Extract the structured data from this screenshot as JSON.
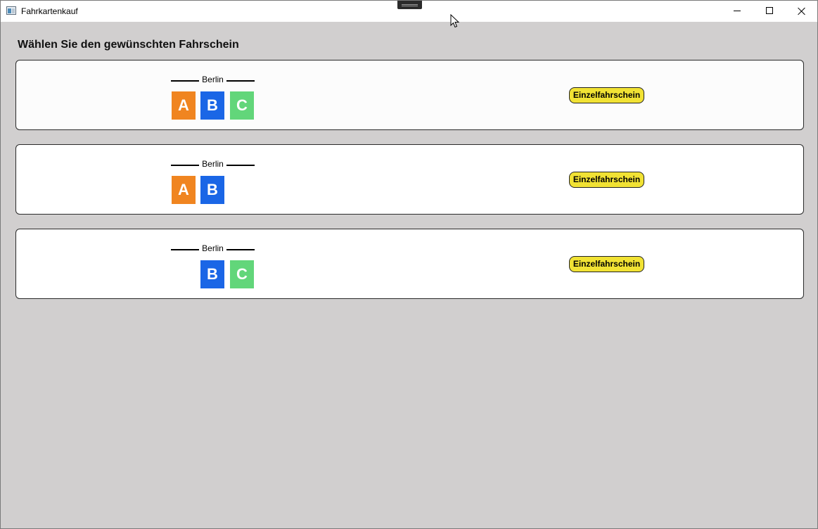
{
  "window": {
    "title": "Fahrkartenkauf",
    "icon": "app-window-icon"
  },
  "heading": "Wählen Sie den gewünschten Fahrschein",
  "colors": {
    "background": "#d1cfcf",
    "card": "#ffffff",
    "zone_a": "#f08520",
    "zone_b": "#1a66e6",
    "zone_c": "#62d67a",
    "button": "#f1e234"
  },
  "tickets": [
    {
      "city": "Berlin",
      "zones": {
        "a": "A",
        "b": "B",
        "c": "C"
      },
      "button_label": "Einzelfahrschein"
    },
    {
      "city": "Berlin",
      "zones": {
        "a": "A",
        "b": "B"
      },
      "button_label": "Einzelfahrschein"
    },
    {
      "city": "Berlin",
      "zones": {
        "b": "B",
        "c": "C"
      },
      "button_label": "Einzelfahrschein"
    }
  ]
}
